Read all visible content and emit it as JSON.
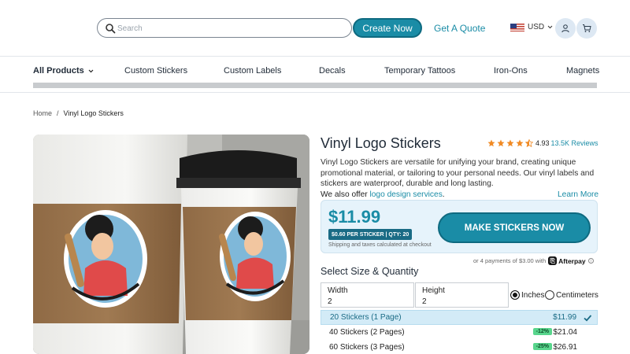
{
  "header": {
    "search_placeholder": "Search",
    "create_label": "Create Now",
    "quote_label": "Get A Quote",
    "currency": "USD"
  },
  "nav": {
    "items": [
      "All Products",
      "Custom Stickers",
      "Custom Labels",
      "Decals",
      "Temporary Tattoos",
      "Iron-Ons",
      "Magnets"
    ]
  },
  "breadcrumb": {
    "home": "Home",
    "sep": "/",
    "current": "Vinyl Logo Stickers"
  },
  "product": {
    "title": "Vinyl Logo Stickers",
    "rating": "4.93",
    "rating_value": 4.93,
    "reviews": "13.5K Reviews",
    "description": "Vinyl Logo Stickers are versatile for unifying your brand, creating unique promotional material, or tailoring to your personal needs. Our vinyl labels and stickers are waterproof, durable and long lasting.",
    "also_prefix": "We also offer ",
    "also_link": "logo design services",
    "also_suffix": ".",
    "learn_more": "Learn More"
  },
  "pricing": {
    "price": "$11.99",
    "per_sticker": "$0.60 PER STICKER | QTY: 20",
    "shipping": "Shipping and taxes calculated at checkout",
    "cta": "MAKE STICKERS NOW",
    "afterpay_text": "or 4 payments of $3.00 with",
    "afterpay_brand": "Afterpay"
  },
  "size": {
    "title": "Select Size & Quantity",
    "width_label": "Width",
    "width_value": "2",
    "height_label": "Height",
    "height_value": "2",
    "unit_inches": "Inches",
    "unit_cm": "Centimeters"
  },
  "quantities": [
    {
      "label": "20 Stickers (1 Page)",
      "price": "$11.99",
      "discount": "",
      "selected": true
    },
    {
      "label": "40 Stickers (2 Pages)",
      "price": "$21.04",
      "discount": "-12%",
      "selected": false
    },
    {
      "label": "60 Stickers (3 Pages)",
      "price": "$26.91",
      "discount": "-25%",
      "selected": false
    }
  ],
  "colors": {
    "accent": "#1a8ca6",
    "accent_dark": "#0e6a80",
    "star": "#f08a24",
    "discount_bg": "#59d68d"
  }
}
